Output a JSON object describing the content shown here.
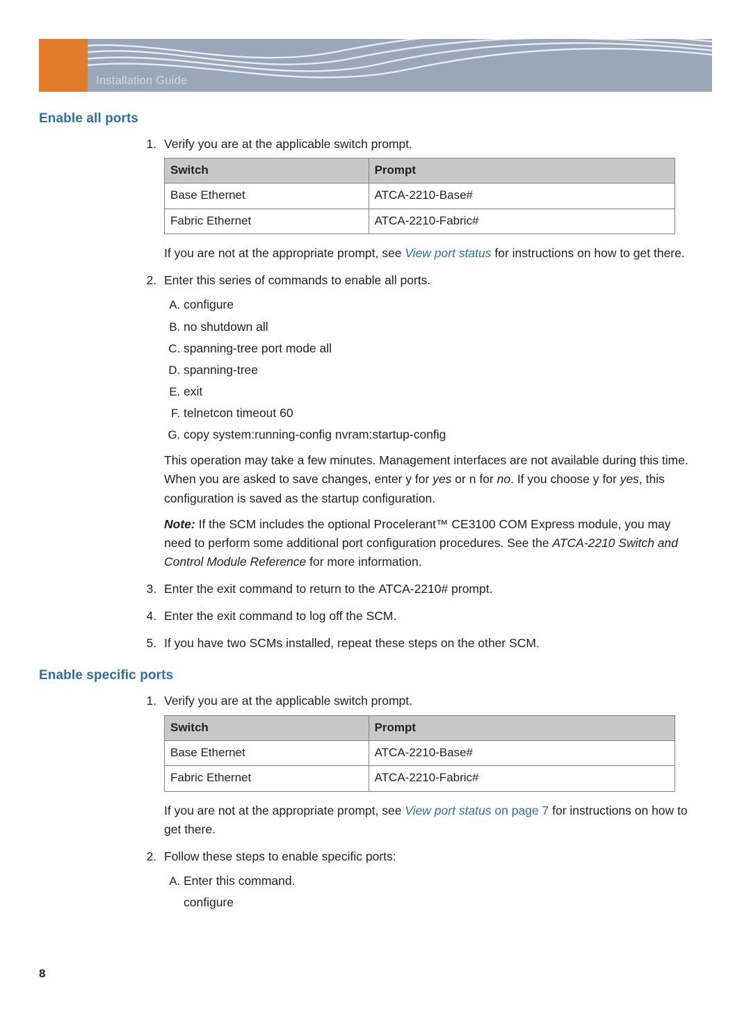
{
  "banner": {
    "title": "Installation Guide"
  },
  "page_number": "8",
  "section1": {
    "heading": "Enable all ports",
    "step1": "Verify you are at the applicable switch prompt.",
    "table": {
      "h1": "Switch",
      "h2": "Prompt",
      "r1c1": "Base Ethernet",
      "r1c2": "ATCA-2210-Base#",
      "r2c1": "Fabric Ethernet",
      "r2c2": "ATCA-2210-Fabric#"
    },
    "note_prefix": "If you are not at the appropriate prompt, see ",
    "note_link": "View port status",
    "note_suffix": " for instructions on how to get there.",
    "step2": "Enter this series of commands to enable all ports.",
    "cmds": {
      "a": "configure",
      "b": "no shutdown all",
      "c": "spanning-tree port mode all",
      "d": "spanning-tree",
      "e": "exit",
      "f": "telnetcon timeout 60",
      "g": "copy system:running-config nvram:startup-config"
    },
    "op_para_a": "This operation may take a few minutes. Management interfaces are not available during this time. When you are asked to save changes, enter ",
    "op_y": "y",
    "op_for_yes": " for ",
    "op_yes": "yes",
    "op_or": " or ",
    "op_n": "n",
    "op_for_no": " for ",
    "op_no": "no",
    "op_ifchoose": ". If you choose ",
    "op_tail": ", this configuration is saved as the startup configuration.",
    "note_label": "Note:",
    "note_body_a": " If the SCM includes the optional Procelerant™ CE3100 COM Express module, you may need to perform some additional port configuration procedures. See the ",
    "note_ref": "ATCA-2210 Switch and Control Module Reference",
    "note_body_b": " for more information.",
    "step3_a": "Enter the ",
    "step3_cmd": "exit ",
    "step3_b": " command to return to the ",
    "step3_prompt": "ATCA-2210#",
    "step3_c": " prompt.",
    "step4_a": "Enter the ",
    "step4_cmd": "exit ",
    "step4_b": " command to log off the SCM.",
    "step5": "If you have two SCMs installed, repeat these steps on the other SCM."
  },
  "section2": {
    "heading": "Enable specific ports",
    "step1": "Verify you are at the applicable switch prompt.",
    "table": {
      "h1": "Switch",
      "h2": "Prompt",
      "r1c1": "Base Ethernet",
      "r1c2": "ATCA-2210-Base#",
      "r2c1": "Fabric Ethernet",
      "r2c2": "ATCA-2210-Fabric#"
    },
    "note_prefix": "If you are not at the appropriate prompt, see ",
    "note_link": "View port status",
    "note_link_suffix": " on page 7",
    "note_suffix": " for instructions on how to get there.",
    "step2": "Follow these steps to enable specific ports:",
    "sub_a": "Enter this command.",
    "sub_a_cmd": "configure"
  }
}
